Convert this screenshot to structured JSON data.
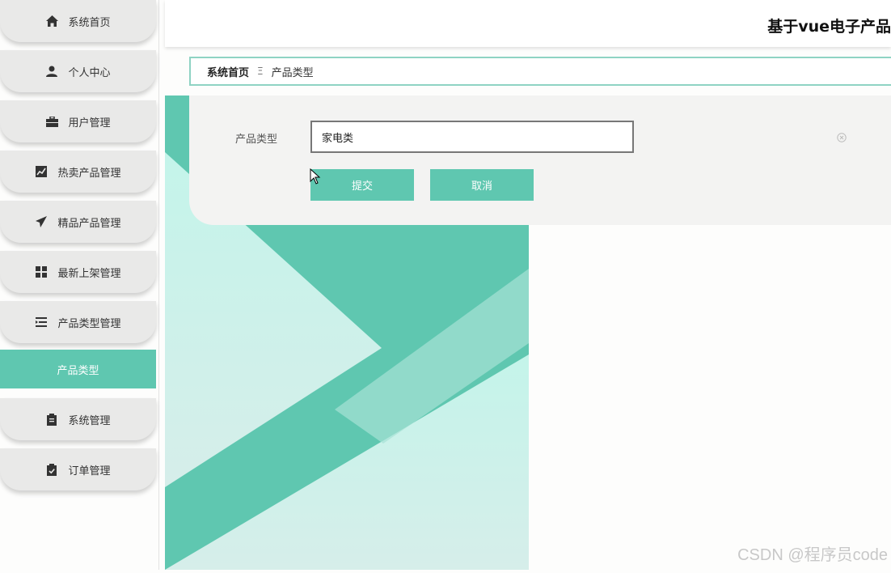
{
  "header": {
    "title": "基于vue电子产品"
  },
  "sidebar": {
    "items": [
      {
        "label": "系统首页",
        "icon": "home-icon"
      },
      {
        "label": "个人中心",
        "icon": "user-icon"
      },
      {
        "label": "用户管理",
        "icon": "briefcase-icon"
      },
      {
        "label": "热卖产品管理",
        "icon": "chart-icon"
      },
      {
        "label": "精品产品管理",
        "icon": "send-icon"
      },
      {
        "label": "最新上架管理",
        "icon": "grid-icon"
      },
      {
        "label": "产品类型管理",
        "icon": "list-indent-icon"
      },
      {
        "label": "产品类型",
        "icon": ""
      },
      {
        "label": "系统管理",
        "icon": "clipboard-icon"
      },
      {
        "label": "订单管理",
        "icon": "clipboard-check-icon"
      }
    ]
  },
  "breadcrumb": {
    "home": "系统首页",
    "separator": "Ξ",
    "current": "产品类型"
  },
  "form": {
    "label": "产品类型",
    "value": "家电类",
    "submit_label": "提交",
    "cancel_label": "取消"
  },
  "watermark": "CSDN @程序员code",
  "colors": {
    "accent": "#5fc7b0",
    "accent_light": "#c4f4ea",
    "menu_bg": "#e9e9e8"
  }
}
